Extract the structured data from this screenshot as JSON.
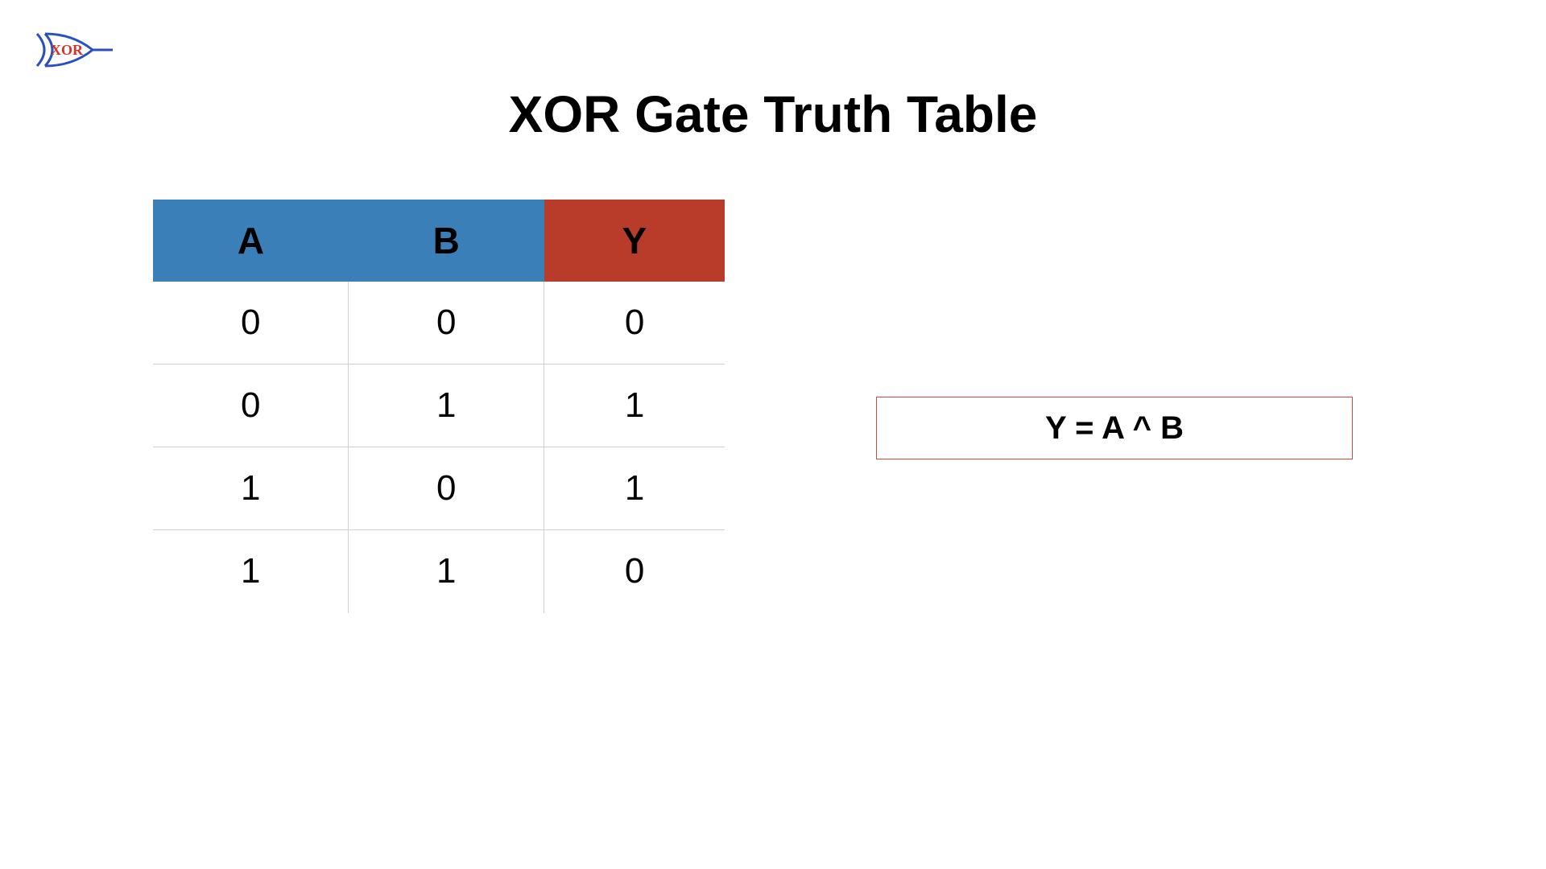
{
  "title": "XOR Gate Truth Table",
  "logo_label": "XOR",
  "table": {
    "headers": {
      "a": "A",
      "b": "B",
      "y": "Y"
    },
    "rows": [
      {
        "a": "0",
        "b": "0",
        "y": "0"
      },
      {
        "a": "0",
        "b": "1",
        "y": "1"
      },
      {
        "a": "1",
        "b": "0",
        "y": "1"
      },
      {
        "a": "1",
        "b": "1",
        "y": "0"
      }
    ]
  },
  "formula": "Y = A ^ B",
  "chart_data": {
    "type": "table",
    "title": "XOR Gate Truth Table",
    "columns": [
      "A",
      "B",
      "Y"
    ],
    "rows": [
      [
        0,
        0,
        0
      ],
      [
        0,
        1,
        1
      ],
      [
        1,
        0,
        1
      ],
      [
        1,
        1,
        0
      ]
    ],
    "equation": "Y = A ^ B"
  }
}
